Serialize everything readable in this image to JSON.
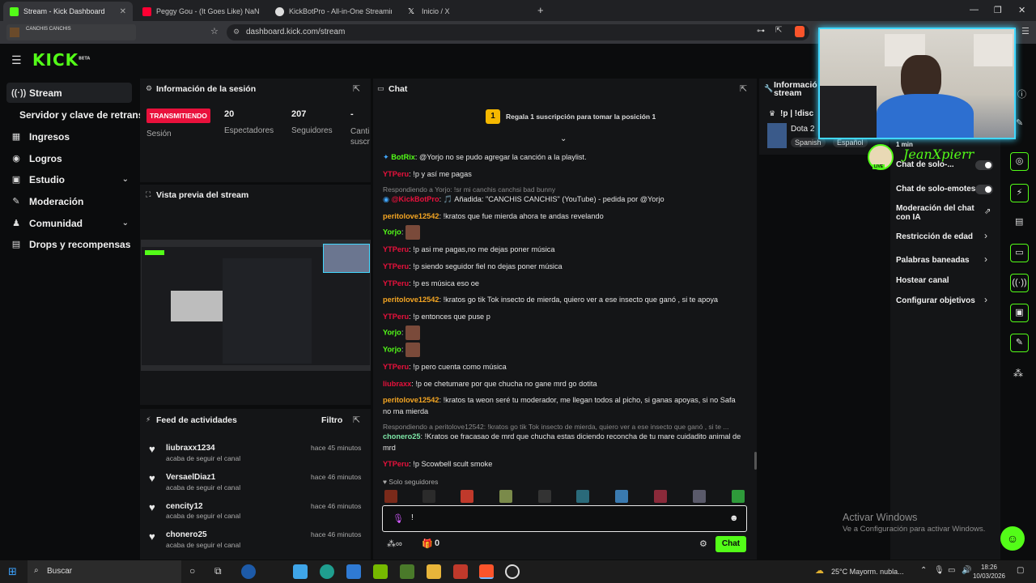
{
  "browser": {
    "tabs": [
      {
        "label": "Stream - Kick Dashboard",
        "icon": "kick-icon",
        "color": "#53fc18"
      },
      {
        "label": "Peggy Gou - (It Goes Like) NaNaNa (",
        "icon": "youtube-icon",
        "color": "#ff0000"
      },
      {
        "label": "KickBotPro - All-in-One Streaming To",
        "icon": "kickbot-icon",
        "color": "#f0f0f0"
      },
      {
        "label": "Inicio / X",
        "icon": "x-icon",
        "color": "#ffffff"
      }
    ],
    "new_tab": "+",
    "url": "dashboard.kick.com/stream",
    "profile_label": "CANCHIS CANCHIS"
  },
  "sidebar": {
    "logo": "KICK",
    "logo_sup": "BETA",
    "items": [
      {
        "label": "Stream",
        "icon": "stream-icon",
        "glyph": "((·))"
      },
      {
        "label": "Servidor y clave de retransm",
        "icon": "",
        "glyph": ""
      },
      {
        "label": "Ingresos",
        "icon": "revenue-icon",
        "glyph": "▦"
      },
      {
        "label": "Logros",
        "icon": "achievements-icon",
        "glyph": "◉"
      },
      {
        "label": "Estudio",
        "icon": "studio-icon",
        "glyph": "▣"
      },
      {
        "label": "Moderación",
        "icon": "moderation-icon",
        "glyph": "✎"
      },
      {
        "label": "Comunidad",
        "icon": "community-icon",
        "glyph": "♟"
      },
      {
        "label": "Drops y recompensas",
        "icon": "drops-icon",
        "glyph": "▤"
      }
    ]
  },
  "session": {
    "title": "Información de la sesión",
    "badge": "TRANSMITIENDO",
    "session_label": "Sesión",
    "viewers": "20",
    "viewers_label": "Espectadores",
    "followers": "207",
    "followers_label": "Seguidores",
    "third": "-",
    "third_label": "Canti\nsuscr"
  },
  "preview": {
    "title": "Vista previa del stream"
  },
  "feed": {
    "title": "Feed de actividades",
    "filter": "Filtro",
    "items": [
      {
        "user": "liubraxx1234",
        "action": "acaba de seguir el canal",
        "time": "hace 45 minutos"
      },
      {
        "user": "VersaelDiaz1",
        "action": "acaba de seguir el canal",
        "time": "hace 46 minutos"
      },
      {
        "user": "cencity12",
        "action": "acaba de seguir el canal",
        "time": "hace 46 minutos"
      },
      {
        "user": "chonero25",
        "action": "acaba de seguir el canal",
        "time": "hace 46 minutos"
      }
    ]
  },
  "chat": {
    "title": "Chat",
    "pinned_rank": "1",
    "pinned_text": "Regala 1 suscripción para tomar la posición 1",
    "messages": [
      {
        "user": "BotRix",
        "color": "#53fc18",
        "text": "@Yorjo no se pudo agregar la canción a la playlist."
      },
      {
        "user": "YTPeru",
        "color": "#e9113c",
        "text": "!p y así me pagas"
      },
      {
        "reply": "Respondiendo a Yorjo: !sr mi canchis canchsi bad bunny"
      },
      {
        "user": "@KickBotPro",
        "color": "#e9113c",
        "text": "🎵 Añadida: \"CANCHIS CANCHIS\" (YouTube) - pedida por @Yorjo"
      },
      {
        "user": "peritolove12542",
        "color": "#f5a623",
        "text": "!kratos que fue mierda ahora te andas revelando"
      },
      {
        "user": "Yorjo",
        "color": "#53fc18",
        "text": "",
        "emote": true
      },
      {
        "user": "YTPeru",
        "color": "#e9113c",
        "text": "!p asi me pagas,no me dejas poner música"
      },
      {
        "user": "YTPeru",
        "color": "#e9113c",
        "text": "!p siendo seguidor fiel no dejas poner música"
      },
      {
        "user": "YTPeru",
        "color": "#e9113c",
        "text": "!p es música eso oe"
      },
      {
        "user": "peritolove12542",
        "color": "#f5a623",
        "text": "!kratos go tik Tok insecto de mierda, quiero ver a ese insecto que ganó , si te apoya"
      },
      {
        "user": "YTPeru",
        "color": "#e9113c",
        "text": "!p entonces que puse p"
      },
      {
        "user": "Yorjo",
        "color": "#53fc18",
        "text": "",
        "emote": true
      },
      {
        "user": "Yorjo",
        "color": "#53fc18",
        "text": "",
        "emote": true
      },
      {
        "user": "YTPeru",
        "color": "#e9113c",
        "text": "!p pero cuenta como música"
      },
      {
        "user": "liubraxx",
        "color": "#e9113c",
        "text": "!p oe chetumare por que chucha no gane mrd go dotita"
      },
      {
        "user": "peritolove12542",
        "color": "#f5a623",
        "text": "!kratos ta weon seré tu moderador, me llegan todos al picho, si ganas apoyas, si no Safa no ma mierda"
      },
      {
        "reply": "Respondiendo a peritolove12542: !kratos go tik Tok insecto de mierda, quiero ver a ese insecto que ganó , si te ..."
      },
      {
        "user": "chonero25",
        "color": "#7ee8a8",
        "text": "!Kratos oe fracasao de mrd que chucha estas diciendo reconcha de tu mare cuidadito animal de mrd"
      },
      {
        "user": "YTPeru",
        "color": "#e9113c",
        "text": "!p Scowbell scult smoke"
      }
    ],
    "followers_only": "Solo seguidores",
    "input_value": "!",
    "points": "0",
    "send_label": "Chat"
  },
  "stream_info": {
    "title": "Información del stream",
    "title_short": "Informació stream",
    "stream_title": "!p | !disc",
    "category": "Dota 2",
    "tags": [
      "Spanish",
      "Español"
    ],
    "time": "1 min"
  },
  "overlay": {
    "name": "JeanXpierr",
    "live": "LIVE"
  },
  "settings": [
    {
      "label": "Chat de solo-...",
      "control": "toggle"
    },
    {
      "label": "Chat de solo-emotes",
      "control": "toggle"
    },
    {
      "label": "Moderación del chat con IA",
      "control": "link"
    },
    {
      "label": "Restricción de edad",
      "control": "chevron"
    },
    {
      "label": "Palabras baneadas",
      "control": "chevron"
    },
    {
      "label": "Hostear canal",
      "control": "none"
    },
    {
      "label": "Configurar objetivos",
      "control": "chevron"
    }
  ],
  "watermark": {
    "title": "Activar Windows",
    "subtitle": "Ve a Configuración para activar Windows."
  },
  "taskbar": {
    "search": "Buscar",
    "weather": "25°C  Mayorm. nubla...",
    "time": "18:26",
    "date": "10/03/2026"
  }
}
